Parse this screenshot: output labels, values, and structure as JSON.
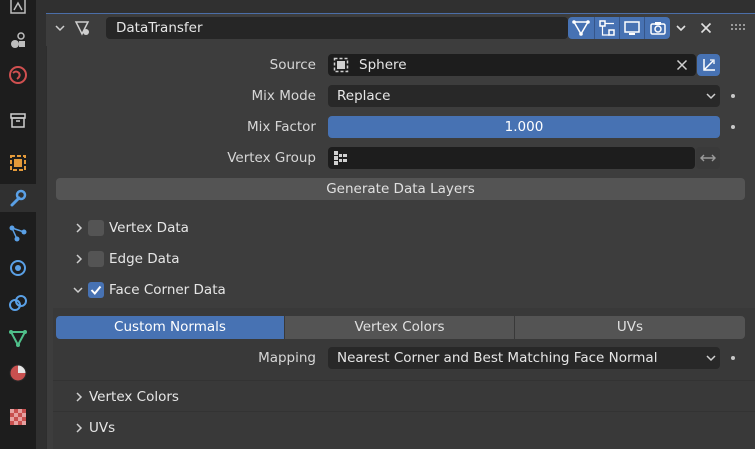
{
  "modifier": {
    "name": "DataTransfer",
    "header_icons": [
      "vertex-filter-icon",
      "edit-mode-icon",
      "viewport-icon",
      "render-icon"
    ]
  },
  "source": {
    "label": "Source",
    "value": "Sphere"
  },
  "mix_mode": {
    "label": "Mix Mode",
    "value": "Replace"
  },
  "mix_factor": {
    "label": "Mix Factor",
    "value": "1.000"
  },
  "vertex_group": {
    "label": "Vertex Group",
    "value": ""
  },
  "generate_button": "Generate Data Layers",
  "sections": [
    {
      "label": "Vertex Data",
      "checked": false,
      "expanded": false
    },
    {
      "label": "Edge Data",
      "checked": false,
      "expanded": false
    },
    {
      "label": "Face Corner Data",
      "checked": true,
      "expanded": true
    }
  ],
  "face_corner_tabs": [
    {
      "label": "Custom Normals",
      "active": true
    },
    {
      "label": "Vertex Colors",
      "active": false
    },
    {
      "label": "UVs",
      "active": false
    }
  ],
  "mapping": {
    "label": "Mapping",
    "value": "Nearest Corner and Best Matching Face Normal"
  },
  "subpanels": [
    {
      "label": "Vertex Colors"
    },
    {
      "label": "UVs"
    }
  ],
  "colors": {
    "accent": "#4772b3",
    "panel": "#3d3d3d",
    "field": "#1d1d1d",
    "button": "#545454"
  }
}
